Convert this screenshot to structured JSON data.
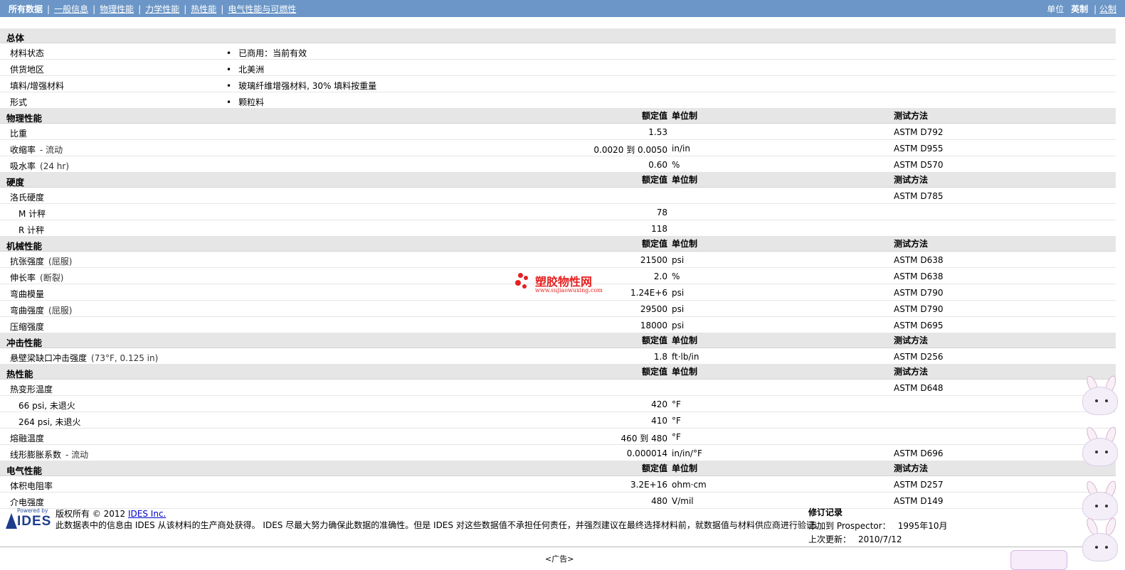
{
  "nav": {
    "all": "所有数据",
    "general": "一般信息",
    "physical": "物理性能",
    "mechanical": "力学性能",
    "thermal": "热性能",
    "electrical": "电气性能与可燃性"
  },
  "units": {
    "label": "单位",
    "imperial": "英制",
    "metric": "公制"
  },
  "headers": {
    "value": "额定值",
    "unit": "单位制",
    "method": "测试方法"
  },
  "general": {
    "title": "总体",
    "rows": [
      {
        "label": "材料状态",
        "value": "已商用：当前有效"
      },
      {
        "label": "供货地区",
        "value": "北美洲"
      },
      {
        "label": "填料/增强材料",
        "value": "玻璃纤维增强材料, 30% 填料按重量"
      },
      {
        "label": "形式",
        "value": "颗粒料"
      }
    ]
  },
  "physical": {
    "title": "物理性能",
    "rows": [
      {
        "label": "比重",
        "note": "",
        "value": "1.53",
        "unit": "",
        "method": "ASTM D792"
      },
      {
        "label": "收缩率",
        "note": "- 流动",
        "value": "0.0020 到  0.0050",
        "unit": "in/in",
        "method": "ASTM D955"
      },
      {
        "label": "吸水率",
        "note": "(24 hr)",
        "value": "0.60",
        "unit": "%",
        "method": "ASTM D570"
      }
    ]
  },
  "hardness": {
    "title": "硬度",
    "rows": [
      {
        "label": "洛氏硬度",
        "value": "",
        "unit": "",
        "method": "ASTM D785"
      },
      {
        "label": "M 计秤",
        "value": "78",
        "unit": "",
        "method": ""
      },
      {
        "label": "R 计秤",
        "value": "118",
        "unit": "",
        "method": ""
      }
    ]
  },
  "mechanical": {
    "title": "机械性能",
    "rows": [
      {
        "label": "抗张强度",
        "note": "(屈服)",
        "value": "21500",
        "unit": "psi",
        "method": "ASTM D638"
      },
      {
        "label": "伸长率",
        "note": "(断裂)",
        "value": "2.0",
        "unit": "%",
        "method": "ASTM D638"
      },
      {
        "label": "弯曲模量",
        "note": "",
        "value": "1.24E+6",
        "unit": "psi",
        "method": "ASTM D790"
      },
      {
        "label": "弯曲强度",
        "note": "(屈服)",
        "value": "29500",
        "unit": "psi",
        "method": "ASTM D790"
      },
      {
        "label": "压缩强度",
        "note": "",
        "value": "18000",
        "unit": "psi",
        "method": "ASTM D695"
      }
    ]
  },
  "impact": {
    "title": "冲击性能",
    "rows": [
      {
        "label": "悬壁梁缺口冲击强度",
        "note": "(73°F, 0.125 in)",
        "value": "1.8",
        "unit": "ft·lb/in",
        "method": "ASTM D256"
      }
    ]
  },
  "thermal": {
    "title": "热性能",
    "rows": [
      {
        "label": "热变形温度",
        "value": "",
        "unit": "",
        "method": "ASTM D648"
      },
      {
        "label": "66 psi, 未退火",
        "value": "420",
        "unit": "°F",
        "method": ""
      },
      {
        "label": "264 psi, 未退火",
        "value": "410",
        "unit": "°F",
        "method": ""
      },
      {
        "label": "熔融温度",
        "value": "460 到  480",
        "unit": "°F",
        "method": ""
      },
      {
        "label": "线形膨胀系数",
        "note": "- 流动",
        "value": "0.000014",
        "unit": "in/in/°F",
        "method": "ASTM D696"
      }
    ]
  },
  "electrical": {
    "title": "电气性能",
    "rows": [
      {
        "label": "体积电阻率",
        "value": "3.2E+16",
        "unit": "ohm·cm",
        "method": "ASTM D257"
      },
      {
        "label": "介电强度",
        "value": "480",
        "unit": "V/mil",
        "method": "ASTM D149"
      }
    ]
  },
  "footer": {
    "logo_top": "Powered by",
    "logo_name": "IDES",
    "copyright_prefix": "版权所有  © 2012",
    "copyright_link": "IDES Inc.",
    "disclaimer": "此数据表中的信息由  IDES 从该材料的生产商处获得。 IDES 尽最大努力确保此数据的准确性。但是  IDES 对这些数据值不承担任何责任，并强烈建议在最终选择材料前，就数据值与材料供应商进行验证。",
    "revision_title": "修订记录",
    "added_label": "添加到  Prospector：",
    "added_value": "1995年10月",
    "updated_label": "上次更新：",
    "updated_value": "2010/7/12"
  },
  "ad": "<广告>",
  "watermark": {
    "name": "塑胶物性网",
    "url": "www.sujiaowuxing.com",
    "color": "#e62020"
  }
}
